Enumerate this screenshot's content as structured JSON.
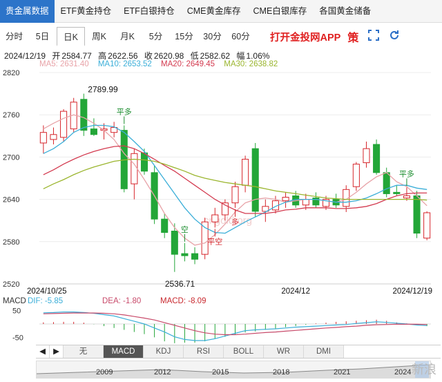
{
  "topnav": {
    "tabs": [
      "贵金属数据",
      "ETF黄金持仓",
      "ETF白银持仓",
      "CME黄金库存",
      "CME白银库存",
      "各国黄金储备"
    ]
  },
  "periods": [
    "分时",
    "5日",
    "日K",
    "周K",
    "月K",
    "5分",
    "15分",
    "30分",
    "60分"
  ],
  "period_active": 2,
  "promo": "打开金投网APP",
  "brand": "策",
  "icons": [
    "fullscreen-icon",
    "refresh-icon"
  ],
  "info": {
    "date": "2024/12/19",
    "open_label": "开",
    "open": "2584.77",
    "high_label": "高",
    "high": "2622.56",
    "close_label": "收",
    "close": "2620.98",
    "low_label": "低",
    "low": "2582.62",
    "amp_label": "幅",
    "amp": "1.06%"
  },
  "ma_labels": [
    {
      "text": "MA5: 2631.40",
      "color": "#e8a3a8"
    },
    {
      "text": "MA10: 2653.52",
      "color": "#3aaed8"
    },
    {
      "text": "MA20: 2649.45",
      "color": "#d33a4f"
    },
    {
      "text": "MA30: 2638.82",
      "color": "#9ab52d"
    }
  ],
  "watermark": "cngold.org",
  "macd_labels": {
    "title": "MACD",
    "dif": "DIF: -5.85",
    "dea": "DEA: -1.80",
    "macd": "MACD: -8.09"
  },
  "tools": [
    "无",
    "MACD",
    "KDJ",
    "RSI",
    "BOLL",
    "WR",
    "DMI"
  ],
  "tool_active": 1,
  "timeline_years": [
    "2009",
    "2012",
    "2015",
    "2018",
    "2021",
    "2024"
  ],
  "logo": "新浪",
  "chart_data": {
    "type": "candlestick",
    "ylim": [
      2520,
      2820
    ],
    "yticks": [
      2520,
      2580,
      2640,
      2700,
      2760,
      2820
    ],
    "xticks": [
      {
        "index": 0,
        "label": "2024/10/25"
      },
      {
        "index": 25,
        "label": "2024/12"
      },
      {
        "index": 37,
        "label": "2024/12/19"
      }
    ],
    "annotations": [
      {
        "index": 4,
        "price": 2789.99,
        "label": "2789.99",
        "type": "high"
      },
      {
        "index": 13,
        "price": 2536.71,
        "label": "2536.71",
        "type": "low"
      },
      {
        "index": 8,
        "label": "平多",
        "pos": "above"
      },
      {
        "index": 14,
        "label": "空",
        "pos": "above"
      },
      {
        "index": 17,
        "label": "平空",
        "pos": "below"
      },
      {
        "index": 19,
        "label": "多",
        "pos": "below"
      },
      {
        "index": 36,
        "label": "平多",
        "pos": "above"
      }
    ],
    "candles": [
      {
        "o": 2720,
        "h": 2745,
        "l": 2705,
        "c": 2735
      },
      {
        "o": 2725,
        "h": 2742,
        "l": 2718,
        "c": 2732
      },
      {
        "o": 2728,
        "h": 2768,
        "l": 2722,
        "c": 2765
      },
      {
        "o": 2740,
        "h": 2784,
        "l": 2735,
        "c": 2778
      },
      {
        "o": 2782,
        "h": 2790,
        "l": 2730,
        "c": 2738
      },
      {
        "o": 2740,
        "h": 2755,
        "l": 2730,
        "c": 2732
      },
      {
        "o": 2738,
        "h": 2748,
        "l": 2725,
        "c": 2740
      },
      {
        "o": 2735,
        "h": 2750,
        "l": 2728,
        "c": 2742
      },
      {
        "o": 2738,
        "h": 2745,
        "l": 2650,
        "c": 2655
      },
      {
        "o": 2662,
        "h": 2712,
        "l": 2640,
        "c": 2705
      },
      {
        "o": 2706,
        "h": 2712,
        "l": 2675,
        "c": 2680
      },
      {
        "o": 2678,
        "h": 2688,
        "l": 2605,
        "c": 2612
      },
      {
        "o": 2612,
        "h": 2620,
        "l": 2585,
        "c": 2593
      },
      {
        "o": 2595,
        "h": 2606,
        "l": 2537,
        "c": 2562
      },
      {
        "o": 2563,
        "h": 2578,
        "l": 2552,
        "c": 2560
      },
      {
        "o": 2563,
        "h": 2572,
        "l": 2548,
        "c": 2555
      },
      {
        "o": 2562,
        "h": 2614,
        "l": 2555,
        "c": 2608
      },
      {
        "o": 2608,
        "h": 2628,
        "l": 2600,
        "c": 2618
      },
      {
        "o": 2618,
        "h": 2640,
        "l": 2610,
        "c": 2635
      },
      {
        "o": 2635,
        "h": 2665,
        "l": 2628,
        "c": 2658
      },
      {
        "o": 2660,
        "h": 2702,
        "l": 2650,
        "c": 2697
      },
      {
        "o": 2712,
        "h": 2720,
        "l": 2615,
        "c": 2623
      },
      {
        "o": 2623,
        "h": 2640,
        "l": 2608,
        "c": 2630
      },
      {
        "o": 2625,
        "h": 2645,
        "l": 2620,
        "c": 2638
      },
      {
        "o": 2638,
        "h": 2650,
        "l": 2628,
        "c": 2643
      },
      {
        "o": 2645,
        "h": 2652,
        "l": 2628,
        "c": 2632
      },
      {
        "o": 2632,
        "h": 2648,
        "l": 2625,
        "c": 2640
      },
      {
        "o": 2642,
        "h": 2650,
        "l": 2628,
        "c": 2632
      },
      {
        "o": 2630,
        "h": 2645,
        "l": 2625,
        "c": 2640
      },
      {
        "o": 2640,
        "h": 2648,
        "l": 2628,
        "c": 2632
      },
      {
        "o": 2630,
        "h": 2660,
        "l": 2622,
        "c": 2654
      },
      {
        "o": 2658,
        "h": 2693,
        "l": 2652,
        "c": 2690
      },
      {
        "o": 2692,
        "h": 2722,
        "l": 2685,
        "c": 2712
      },
      {
        "o": 2718,
        "h": 2725,
        "l": 2675,
        "c": 2678
      },
      {
        "o": 2678,
        "h": 2685,
        "l": 2643,
        "c": 2648
      },
      {
        "o": 2650,
        "h": 2660,
        "l": 2645,
        "c": 2648
      },
      {
        "o": 2642,
        "h": 2657,
        "l": 2638,
        "c": 2645
      },
      {
        "o": 2645,
        "h": 2652,
        "l": 2585,
        "c": 2592
      },
      {
        "o": 2585,
        "h": 2623,
        "l": 2582,
        "c": 2621
      }
    ],
    "ma": [
      {
        "name": "MA5",
        "color": "#e8a3a8",
        "values": [
          2740,
          2748,
          2755,
          2760,
          2756,
          2748,
          2738,
          2725,
          2705,
          2690,
          2668,
          2645,
          2620,
          2600,
          2585,
          2575,
          2578,
          2590,
          2605,
          2622,
          2635,
          2640,
          2642,
          2640,
          2636,
          2638,
          2640,
          2640,
          2638,
          2636,
          2640,
          2650,
          2662,
          2672,
          2678,
          2665,
          2658,
          2645,
          2631
        ]
      },
      {
        "name": "MA10",
        "color": "#3aaed8",
        "values": [
          2705,
          2712,
          2722,
          2735,
          2742,
          2745,
          2745,
          2743,
          2735,
          2722,
          2708,
          2688,
          2668,
          2648,
          2628,
          2612,
          2600,
          2593,
          2592,
          2600,
          2608,
          2615,
          2622,
          2630,
          2636,
          2640,
          2640,
          2640,
          2638,
          2636,
          2636,
          2638,
          2642,
          2648,
          2655,
          2660,
          2660,
          2656,
          2654
        ]
      },
      {
        "name": "MA20",
        "color": "#d33a4f",
        "values": [
          2675,
          2682,
          2690,
          2697,
          2703,
          2708,
          2712,
          2715,
          2716,
          2712,
          2705,
          2697,
          2688,
          2680,
          2670,
          2660,
          2650,
          2640,
          2632,
          2625,
          2620,
          2620,
          2620,
          2622,
          2625,
          2626,
          2628,
          2628,
          2628,
          2627,
          2627,
          2628,
          2630,
          2634,
          2640,
          2645,
          2648,
          2649,
          2649
        ]
      },
      {
        "name": "MA30",
        "color": "#9ab52d",
        "values": [
          2655,
          2662,
          2668,
          2675,
          2681,
          2686,
          2690,
          2694,
          2696,
          2697,
          2696,
          2694,
          2690,
          2685,
          2680,
          2674,
          2670,
          2667,
          2664,
          2662,
          2660,
          2658,
          2655,
          2652,
          2650,
          2648,
          2646,
          2644,
          2642,
          2641,
          2640,
          2640,
          2640,
          2640,
          2640,
          2640,
          2640,
          2640,
          2639
        ]
      }
    ],
    "macd": {
      "ylim": [
        -75,
        75
      ],
      "yticks": [
        50,
        -50
      ],
      "dif": [
        42,
        43,
        45,
        45,
        43,
        40,
        35,
        30,
        20,
        10,
        0,
        -15,
        -30,
        -48,
        -58,
        -62,
        -62,
        -55,
        -45,
        -35,
        -25,
        -22,
        -20,
        -18,
        -15,
        -12,
        -10,
        -8,
        -6,
        -4,
        -2,
        2,
        5,
        8,
        6,
        3,
        0,
        -4,
        -6
      ],
      "dea": [
        38,
        39,
        40,
        41,
        41,
        41,
        40,
        38,
        34,
        28,
        22,
        15,
        5,
        -5,
        -15,
        -25,
        -33,
        -38,
        -40,
        -40,
        -38,
        -35,
        -32,
        -30,
        -27,
        -24,
        -21,
        -18,
        -15,
        -13,
        -10,
        -8,
        -5,
        -3,
        -2,
        -1,
        -1,
        -1,
        -2
      ],
      "hist": [
        6,
        7,
        8,
        8,
        5,
        -1,
        -8,
        -15,
        -22,
        -30,
        -38,
        -50,
        -65,
        -72,
        -70,
        -70,
        -65,
        -55,
        -48,
        -40,
        -32,
        -28,
        -22,
        -18,
        -12,
        -8,
        -3,
        2,
        5,
        8,
        10,
        12,
        14,
        16,
        12,
        6,
        2,
        -5,
        -8
      ]
    }
  }
}
